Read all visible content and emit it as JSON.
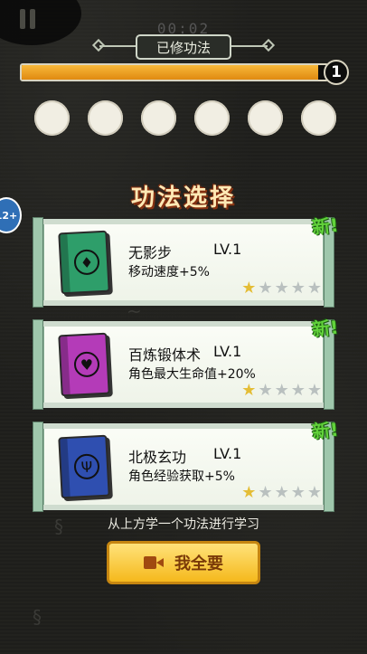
{
  "timer": "00:02",
  "header": {
    "title": "已修功法"
  },
  "progress": {
    "fraction": 0.97,
    "level": "1"
  },
  "slots": {
    "count": 6
  },
  "section_title": "功法选择",
  "side_badge": "12+",
  "cards": [
    {
      "name": "无影步",
      "level": "LV.1",
      "desc": "移动速度+5%",
      "new_label": "新!",
      "stars": 1,
      "max_stars": 5,
      "book_color": "#2e9e6a",
      "emblem": "boot-icon"
    },
    {
      "name": "百炼锻体术",
      "level": "LV.1",
      "desc": "角色最大生命值+20%",
      "new_label": "新!",
      "stars": 1,
      "max_stars": 5,
      "book_color": "#b43bb8",
      "emblem": "heart-icon"
    },
    {
      "name": "北极玄功",
      "level": "LV.1",
      "desc": "角色经验获取+5%",
      "new_label": "新!",
      "stars": 1,
      "max_stars": 5,
      "book_color": "#2f4fb0",
      "emblem": "rune-icon"
    }
  ],
  "hint": "从上方学一个功法进行学习",
  "button": {
    "label": "我全要",
    "icon": "video-icon"
  }
}
